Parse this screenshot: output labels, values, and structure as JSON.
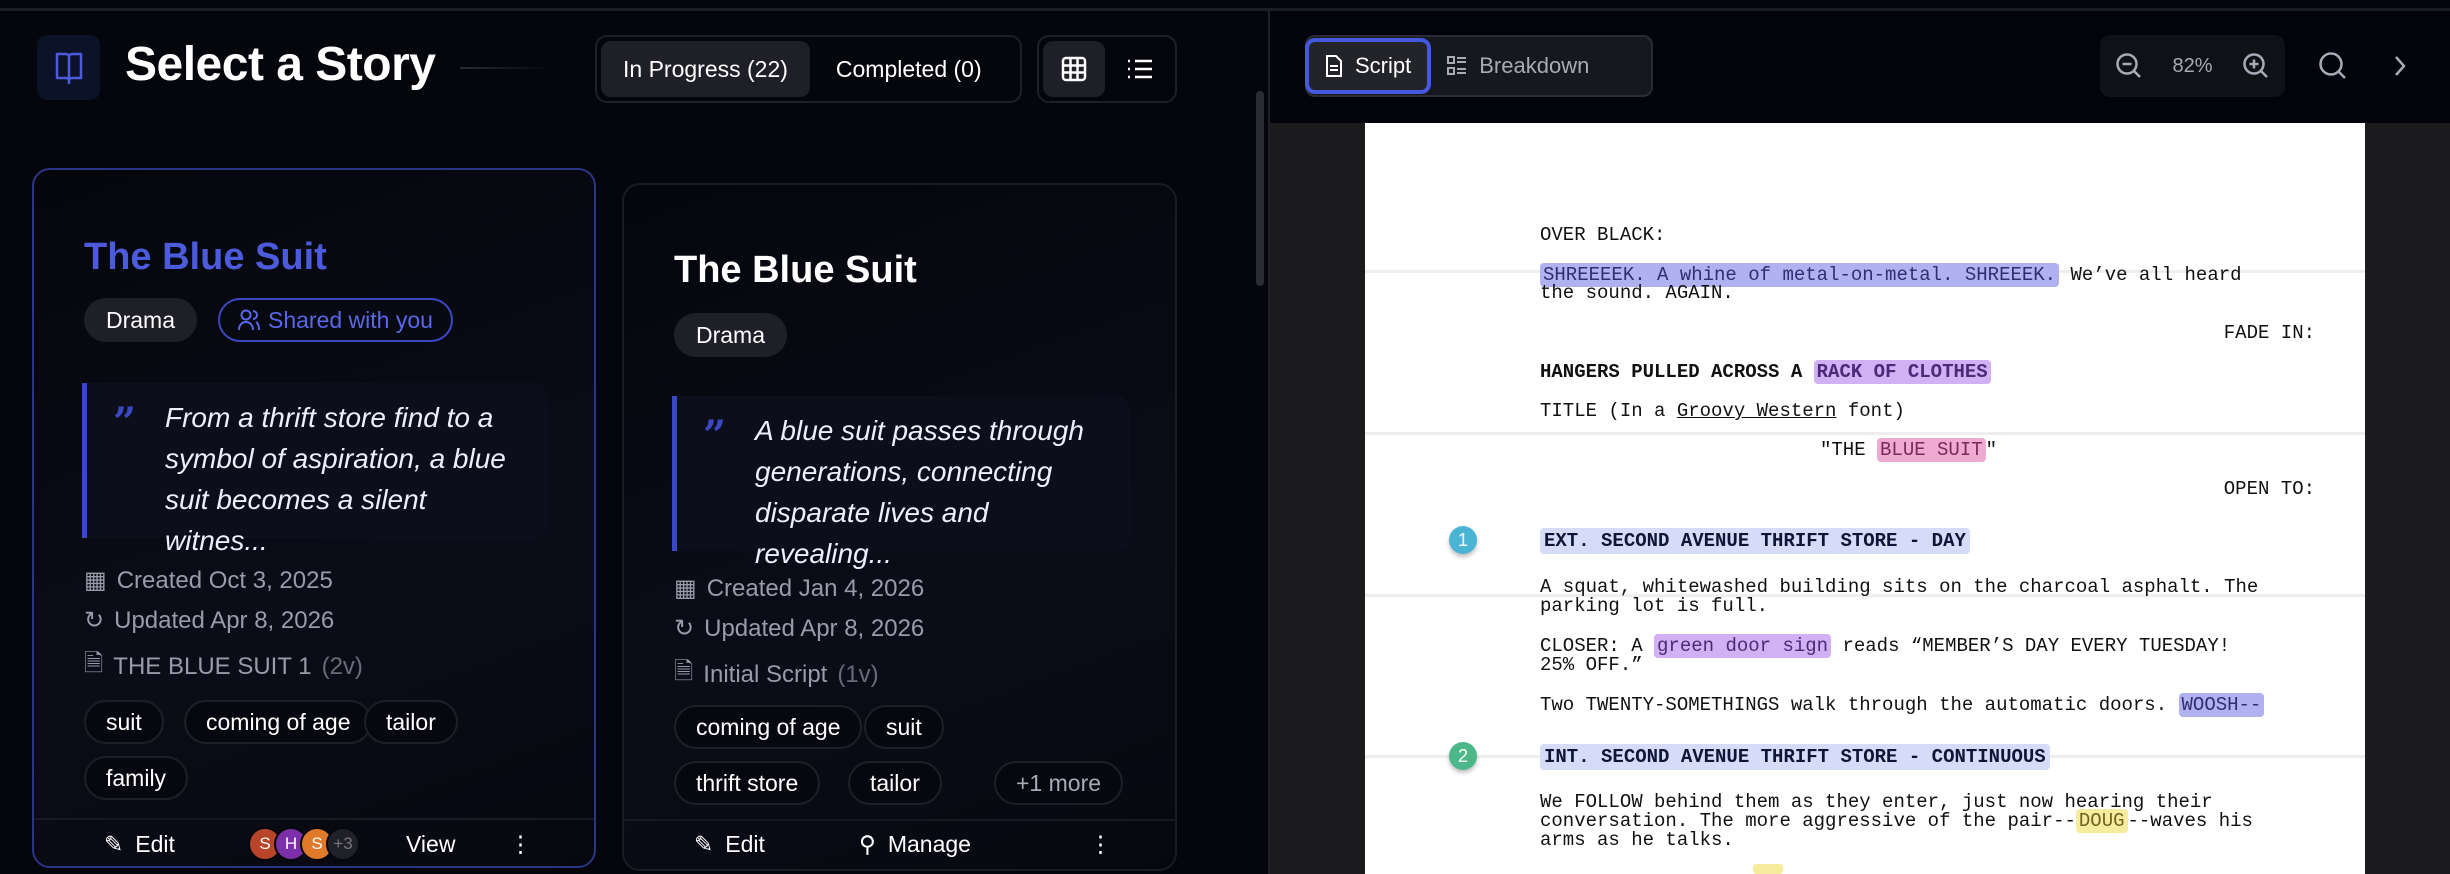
{
  "header": {
    "title": "Select a Story",
    "tabs": [
      {
        "label": "In Progress (22)",
        "active": true
      },
      {
        "label": "Completed (0)",
        "active": false
      }
    ]
  },
  "stories": [
    {
      "title": "The Blue Suit",
      "genre": "Drama",
      "shared_label": "Shared with you",
      "logline": "From a thrift store find to a symbol of aspiration, a blue suit becomes a silent witnes...",
      "created": "Created Oct 3, 2025",
      "updated": "Updated Apr 8, 2026",
      "script": "THE BLUE SUIT 1",
      "versions": "(2v)",
      "tags": [
        "suit",
        "coming of age",
        "tailor",
        "family"
      ],
      "footer": {
        "edit": "Edit",
        "view": "View",
        "avatars": [
          {
            "initial": "S",
            "color": "#b8452a"
          },
          {
            "initial": "H",
            "color": "#7b2fa8"
          },
          {
            "initial": "S",
            "color": "#e07a2a"
          },
          {
            "initial": "+3",
            "color": "#1f2028"
          }
        ]
      }
    },
    {
      "title": "The Blue Suit",
      "genre": "Drama",
      "logline": "A blue suit passes through generations, connecting disparate lives and revealing...",
      "created": "Created Jan 4, 2026",
      "updated": "Updated Apr 8, 2026",
      "script": "Initial Script",
      "versions": "(1v)",
      "tags": [
        "coming of age",
        "suit",
        "thrift store",
        "tailor"
      ],
      "more_tags": "+1 more",
      "footer": {
        "edit": "Edit",
        "manage": "Manage"
      }
    }
  ],
  "viewer": {
    "tabs": [
      {
        "label": "Script",
        "active": true
      },
      {
        "label": "Breakdown",
        "active": false
      }
    ],
    "zoom": "82%"
  },
  "script": {
    "over_black": "OVER BLACK:",
    "shreek_hl": "SHREEEEK. A whine of metal-on-metal. SHREEEK.",
    "shreek_rest": " We’ve all heard",
    "shreek_line2": "the sound. AGAIN.",
    "fade_in": "FADE IN:",
    "hangers": "HANGERS PULLED ACROSS A ",
    "rack": "RACK OF CLOTHES",
    "title_pre": "TITLE (In a ",
    "title_font": "Groovy Western",
    "title_post": " font)",
    "the_pre": "\"THE ",
    "blue_suit": "BLUE SUIT",
    "the_post": "\"",
    "open_to": "OPEN TO:",
    "scenes": [
      {
        "number": "1",
        "color": "#4bb3d4",
        "heading": "EXT. SECOND AVENUE THRIFT STORE - DAY"
      },
      {
        "number": "2",
        "color": "#4cb88a",
        "heading": "INT. SECOND AVENUE THRIFT STORE - CONTINUOUS"
      }
    ],
    "squat1": "A squat, whitewashed building sits on the charcoal asphalt. The",
    "squat2": "parking lot is full.",
    "closer_pre": "CLOSER: A ",
    "door_sign": "green door sign",
    "closer_post": " reads “MEMBER’S DAY EVERY TUESDAY!",
    "closer2": "25% OFF.”",
    "two": "Two TWENTY-SOMETHINGS walk through the automatic doors. ",
    "woosh": "WOOSH--",
    "follow1": "We FOLLOW behind them as they enter, just now hearing their",
    "follow2_pre": "conversation. The more aggressive of the pair--",
    "doug": "DOUG",
    "follow2_post": "--waves his",
    "follow3": "arms as he talks."
  }
}
